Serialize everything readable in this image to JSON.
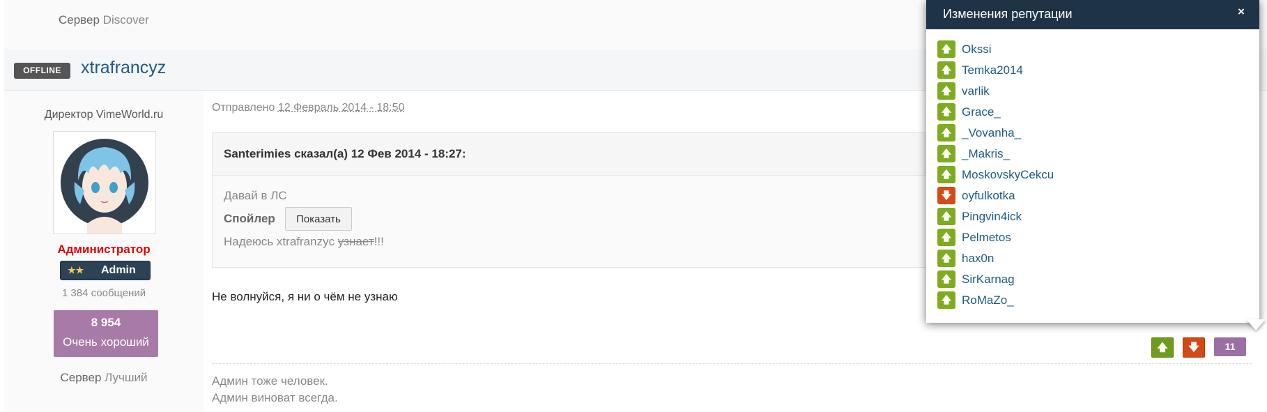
{
  "top": {
    "server_label": "Сервер",
    "server_value": "Discover"
  },
  "post": {
    "status_badge": "OFFLINE",
    "author": "xtrafrancyz",
    "meta_prefix": "Отправлено",
    "date": "12 Февраль 2014 - 18:50",
    "quote": {
      "header": "Santerimies сказал(а) 12 Фев 2014 - 18:27:",
      "line1": "Давай в ЛС",
      "spoiler_label": "Спойлер",
      "spoiler_button": "Показать",
      "line3_text": "Надеюсь xtrafranzyc ",
      "line3_strike": "узнает",
      "line3_tail": "!!!"
    },
    "body": "Не волнуйся, я ни о чём не узнаю",
    "signature": {
      "line1": "Админ тоже человек.",
      "line2": "Админ виноват всегда."
    },
    "vote_up_icon": "arrow-up-icon",
    "vote_down_icon": "arrow-down-icon",
    "rep_count": "11"
  },
  "author_info": {
    "title": "Директор VimeWorld.ru",
    "group": "Администратор",
    "badge_stars": "★★",
    "badge_label": "Admin",
    "post_count": "1 384 сообщений",
    "reputation": "8 954",
    "reputation_desc": "Очень хороший",
    "server_label": "Сервер",
    "server_value": "Лучший"
  },
  "popup": {
    "title": "Изменения репутации",
    "close": "×",
    "items": [
      {
        "name": "Okssi",
        "type": "up"
      },
      {
        "name": "Temka2014",
        "type": "up"
      },
      {
        "name": "varlik",
        "type": "up"
      },
      {
        "name": "Grace_",
        "type": "up"
      },
      {
        "name": "_Vovanha_",
        "type": "up"
      },
      {
        "name": "_Makris_",
        "type": "up"
      },
      {
        "name": "MoskovskyCekcu",
        "type": "up"
      },
      {
        "name": "oyfulkotka",
        "type": "down"
      },
      {
        "name": "Pingvin4ick",
        "type": "up"
      },
      {
        "name": "Pelmetos",
        "type": "up"
      },
      {
        "name": "hax0n",
        "type": "up"
      },
      {
        "name": "SirKarnag",
        "type": "up"
      },
      {
        "name": "RoMaZo_",
        "type": "up"
      }
    ]
  },
  "colors": {
    "header_dark": "#1f3347",
    "link": "#1c5a86",
    "admin_red": "#e00000",
    "rep_purple": "#a77aa8",
    "vote_up": "#7dac1e",
    "vote_down": "#d74a16"
  }
}
